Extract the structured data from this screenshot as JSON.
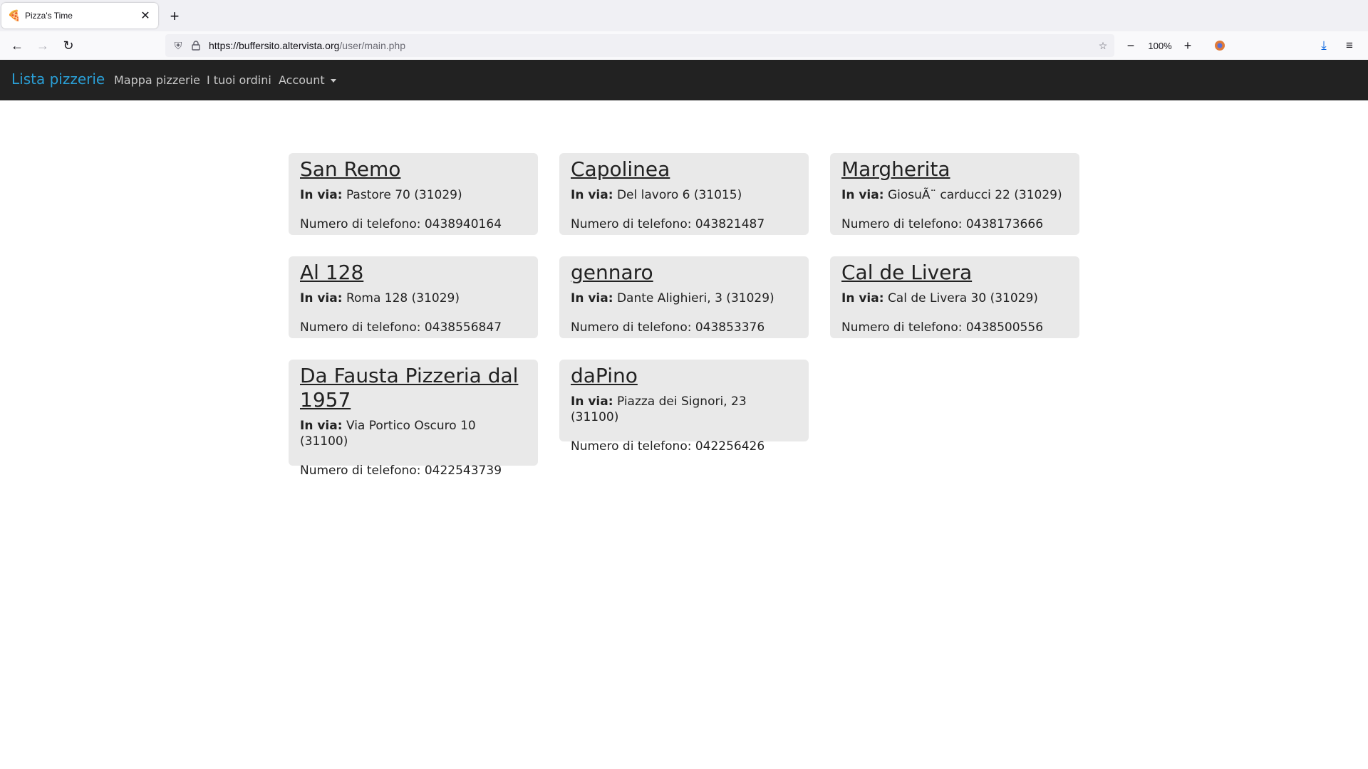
{
  "browser": {
    "tab_title": "Pizza's Time",
    "tab_icon": "pizza-icon",
    "url_host": "https://buffersito.altervista.org",
    "url_path": "/user/main.php",
    "zoom": "100%"
  },
  "navbar": {
    "brand": "Lista pizzerie",
    "links": [
      "Mappa pizzerie",
      "I tuoi ordini"
    ],
    "account": "Account"
  },
  "pizzerie": [
    {
      "name": "San Remo",
      "addr_label": "In via:",
      "addr": "Pastore 70 (31029)",
      "phone": "Numero di telefono: 0438940164"
    },
    {
      "name": "Capolinea",
      "addr_label": "In via:",
      "addr": "Del lavoro 6 (31015)",
      "phone": "Numero di telefono: 043821487"
    },
    {
      "name": "Margherita",
      "addr_label": "In via:",
      "addr": "GiosuÃ¨ carducci 22 (31029)",
      "phone": "Numero di telefono: 0438173666"
    },
    {
      "name": "Al 128",
      "addr_label": "In via:",
      "addr": "Roma 128 (31029)",
      "phone": "Numero di telefono: 0438556847"
    },
    {
      "name": "gennaro",
      "addr_label": "In via:",
      "addr": "Dante Alighieri, 3 (31029)",
      "phone": "Numero di telefono: 043853376"
    },
    {
      "name": "Cal de Livera",
      "addr_label": "In via:",
      "addr": "Cal de Livera 30 (31029)",
      "phone": "Numero di telefono: 0438500556"
    },
    {
      "name": "Da Fausta Pizzeria dal 1957",
      "addr_label": "In via:",
      "addr": "Via Portico Oscuro 10 (31100)",
      "phone": "Numero di telefono: 0422543739"
    },
    {
      "name": "daPino",
      "addr_label": "In via:",
      "addr": "Piazza dei Signori, 23 (31100)",
      "phone": "Numero di telefono: 042256426"
    }
  ]
}
